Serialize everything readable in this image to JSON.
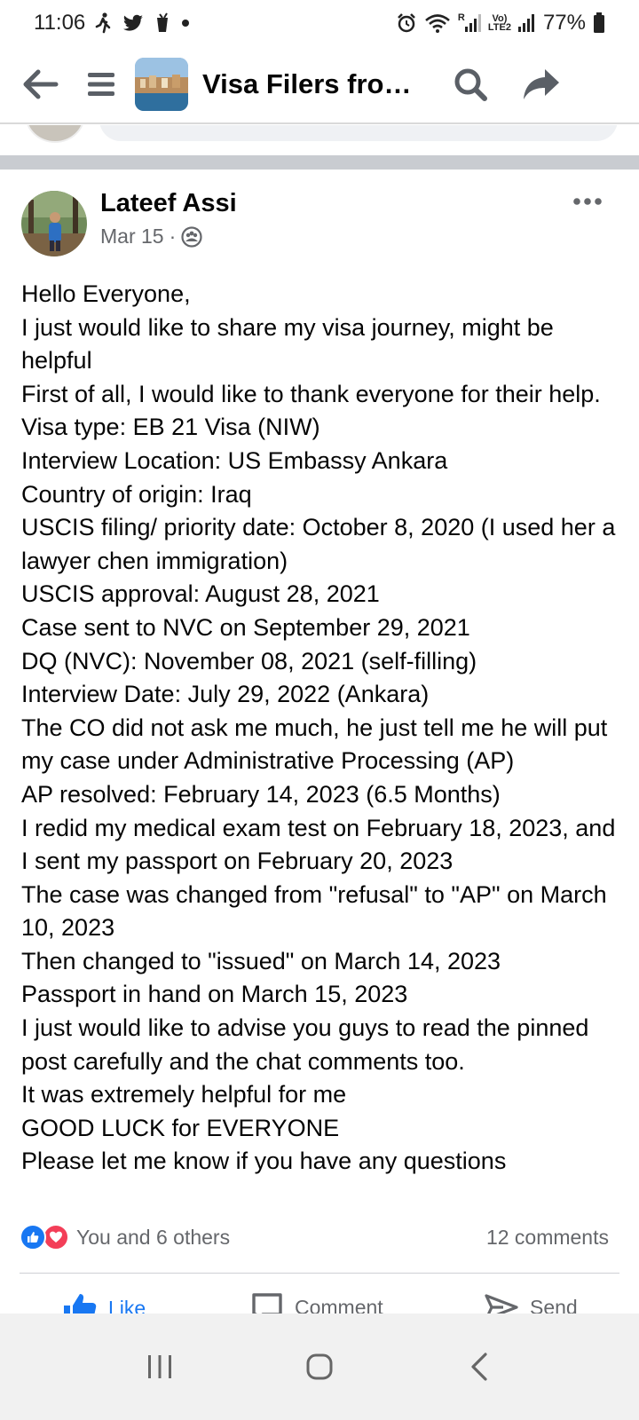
{
  "status_bar": {
    "time": "11:06",
    "battery": "77%",
    "network_small_top": "Vo)",
    "network_small_bottom": "LTE2",
    "signal_letter": "R"
  },
  "header": {
    "group_title": "Visa Filers from..."
  },
  "post": {
    "author": "Lateef Assi",
    "date": "Mar 15",
    "meta_separator": "·",
    "lines": [
      "Hello Everyone,",
      "I just would like to share my visa journey, might be helpful",
      "First of all, I would like to thank everyone for their help.",
      "Visa type: EB 21 Visa (NIW)",
      "Interview Location: US Embassy Ankara",
      "Country of origin: Iraq",
      "USCIS filing/ priority date: October 8, 2020 (I used her a lawyer chen immigration)",
      "USCIS approval: August 28, 2021",
      "Case sent to NVC on September 29, 2021",
      "DQ (NVC): November 08, 2021 (self-filling)",
      "Interview Date: July 29, 2022 (Ankara)",
      "The CO did not ask me much, he just tell me he will put my case under Administrative Processing (AP)",
      "AP resolved: February 14, 2023 (6.5 Months)",
      "I redid my medical exam test on February 18, 2023, and I sent my passport on February 20, 2023",
      "The case was changed from \"refusal\" to \"AP\" on March 10, 2023",
      "Then changed to \"issued\" on March 14, 2023",
      "Passport in hand on March 15, 2023",
      "I just would like to advise you guys to read the pinned post carefully and the chat comments too.",
      "It was extremely helpful for me",
      "GOOD LUCK for EVERYONE",
      "Please let me know if you have any questions"
    ],
    "reactions_text": "You and 6 others",
    "comments_count": "12 comments"
  },
  "actions": {
    "like": "Like",
    "comment": "Comment",
    "send": "Send"
  },
  "colors": {
    "brand_blue": "#1877f2",
    "love_red": "#f33e58",
    "secondary_text": "#65676b",
    "separator": "#c9ccd1"
  }
}
